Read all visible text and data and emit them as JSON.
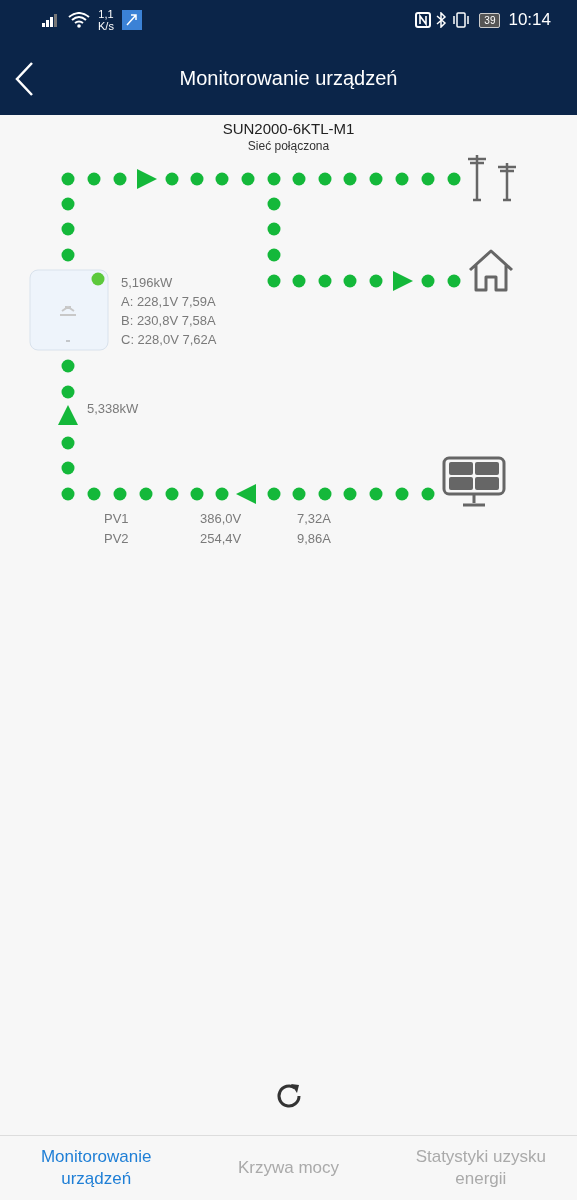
{
  "status_bar": {
    "speed_value": "1,1",
    "speed_unit": "K/s",
    "battery": "39",
    "time": "10:14"
  },
  "header": {
    "title": "Monitorowanie urządzeń"
  },
  "device": {
    "model": "SUN2000-6KTL-M1",
    "status": "Sieć połączona",
    "online": true
  },
  "inverter": {
    "power": "5,196kW",
    "phases": [
      "A: 228,1V 7,59A",
      "B: 230,8V 7,58A",
      "C: 228,0V 7,62A"
    ]
  },
  "pv": {
    "power": "5,338kW",
    "strings": [
      {
        "name": "PV1",
        "voltage": "386,0V",
        "current": "7,32A"
      },
      {
        "name": "PV2",
        "voltage": "254,4V",
        "current": "9,86A"
      }
    ]
  },
  "tabs": [
    {
      "label": "Monitorowanie urządzeń",
      "selected": true
    },
    {
      "label": "Krzywa mocy",
      "selected": false
    },
    {
      "label": "Statystyki uzysku energii",
      "selected": false
    }
  ]
}
